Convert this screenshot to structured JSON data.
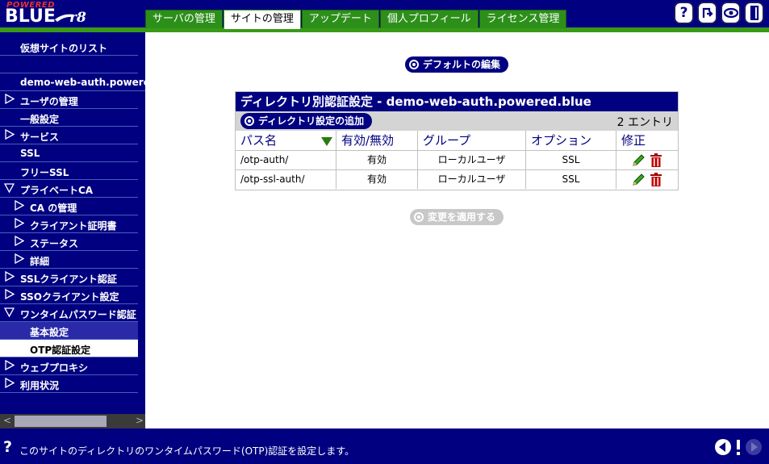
{
  "logo": {
    "powered": "POWERED",
    "blue": "BLUE",
    "version": "r8"
  },
  "tabs": [
    {
      "label": "サーバの管理",
      "active": false
    },
    {
      "label": "サイトの管理",
      "active": true
    },
    {
      "label": "アップデート",
      "active": false
    },
    {
      "label": "個人プロフィール",
      "active": false
    },
    {
      "label": "ライセンス管理",
      "active": false
    }
  ],
  "top_icons": [
    "help-icon",
    "logout-icon",
    "view-icon",
    "exit-icon"
  ],
  "sidebar": {
    "items": [
      {
        "label": "仮想サイトのリスト",
        "indent": 0,
        "arrow": false
      },
      {
        "label": "",
        "indent": 0,
        "arrow": false
      },
      {
        "label": "demo-web-auth.powered.blue",
        "indent": 0,
        "arrow": false
      },
      {
        "label": "ユーザの管理",
        "indent": 0,
        "arrow": "right"
      },
      {
        "label": "一般設定",
        "indent": 0,
        "arrow": false
      },
      {
        "label": "サービス",
        "indent": 0,
        "arrow": "right"
      },
      {
        "label": "SSL",
        "indent": 0,
        "arrow": false
      },
      {
        "label": "フリーSSL",
        "indent": 0,
        "arrow": false
      },
      {
        "label": "プライベートCA",
        "indent": 0,
        "arrow": "down"
      },
      {
        "label": "CA の管理",
        "indent": 1,
        "arrow": "right"
      },
      {
        "label": "クライアント証明書",
        "indent": 1,
        "arrow": "right"
      },
      {
        "label": "ステータス",
        "indent": 1,
        "arrow": "right"
      },
      {
        "label": "詳細",
        "indent": 1,
        "arrow": "right"
      },
      {
        "label": "SSLクライアント認証",
        "indent": 0,
        "arrow": "right"
      },
      {
        "label": "SSOクライアント設定",
        "indent": 0,
        "arrow": "right"
      },
      {
        "label": "ワンタイムパスワード認証",
        "indent": 0,
        "arrow": "down"
      },
      {
        "label": "基本設定",
        "indent": 1,
        "arrow": false
      },
      {
        "label": "OTP認証設定",
        "indent": 1,
        "arrow": false
      },
      {
        "label": "ウェブプロキシ",
        "indent": 0,
        "arrow": "right"
      },
      {
        "label": "利用状況",
        "indent": 0,
        "arrow": "right"
      }
    ],
    "selected_index": 16,
    "current_index": 17
  },
  "main": {
    "default_edit_label": "デフォルトの編集",
    "table_title": "ディレクトリ別認証設定 - demo-web-auth.powered.blue",
    "add_dir_label": "ディレクトリ設定の追加",
    "entry_count": "2 エントリ",
    "columns": [
      "パス名",
      "有効/無効",
      "グループ",
      "オプション",
      "修正"
    ],
    "rows": [
      {
        "path": "/otp-auth/",
        "enabled": "有効",
        "group": "ローカルユーザ",
        "option": "SSL"
      },
      {
        "path": "/otp-ssl-auth/",
        "enabled": "有効",
        "group": "ローカルユーザ",
        "option": "SSL"
      }
    ],
    "apply_label": "変更を適用する"
  },
  "status": {
    "help": "?",
    "text": "このサイトのディレクトリのワンタイムパスワード(OTP)認証を設定します。"
  },
  "colors": {
    "navy": "#000080",
    "green_tab": "#2c8f1a",
    "stripe": "#3a9a18"
  }
}
